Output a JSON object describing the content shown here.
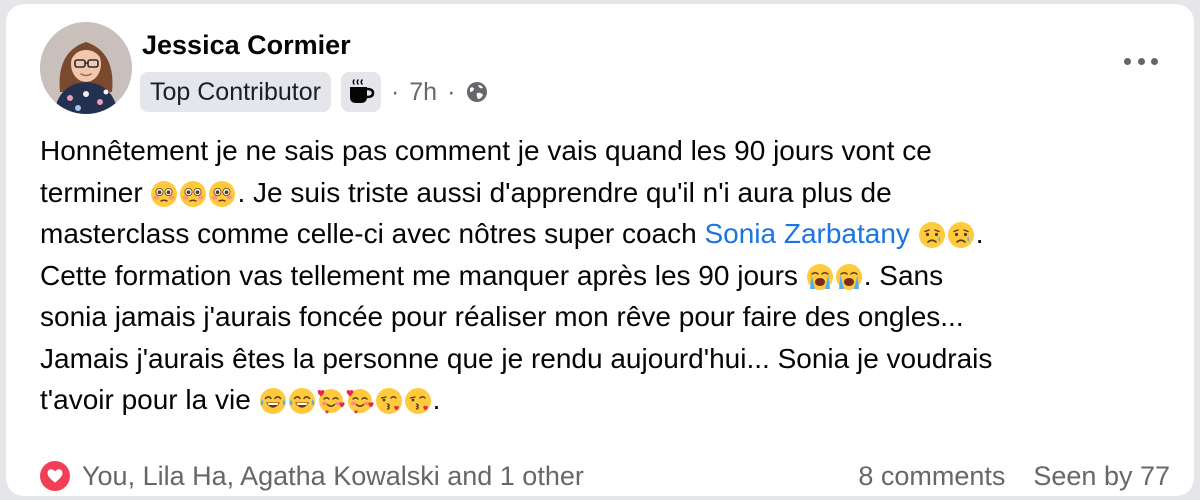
{
  "post": {
    "author": "Jessica Cormier",
    "badge": "Top Contributor",
    "badge_icon": "coffee-cup-icon",
    "time": "7h",
    "separator": "·",
    "audience_icon": "globe-icon",
    "menu_icon": "more-options-icon",
    "text": {
      "l1": "Honnêtement je ne sais pas comment je vais quand les 90 jours vont ce",
      "l2a": "terminer",
      "l2b": ". Je suis triste aussi d'apprendre qu'il n'i aura plus de",
      "l3a": "masterclass comme celle-ci avec nôtres super coach ",
      "mention": "Sonia Zarbatany",
      "l3b": ".",
      "l4a": "Cette formation vas tellement me manquer après les 90 jours",
      "l4b": ". Sans",
      "l5": "sonia jamais j'aurais foncée pour réaliser mon rêve pour faire des ongles...",
      "l6": "Jamais j'aurais êtes la personne que je rendu aujourd'hui... Sonia je voudrais",
      "l7a": "t'avoir pour la vie",
      "l7b": "."
    },
    "emojis": {
      "flushed": "flushed-face-emoji",
      "sad": "sad-relieved-face-emoji",
      "crying": "loudly-crying-face-emoji",
      "joy": "tears-of-joy-emoji",
      "hearts": "smiling-face-with-hearts-emoji",
      "kiss": "face-blowing-kiss-emoji"
    }
  },
  "footer": {
    "reaction_icon": "love-reaction-icon",
    "reactors": "You, Lila Ha, Agatha Kowalski and 1 other",
    "comments": "8 comments",
    "seen": "Seen by 77"
  },
  "colors": {
    "mention": "#1b74e4",
    "secondary_text": "#65676b",
    "love": "#f33e58",
    "badge_bg": "#e4e6eb"
  }
}
